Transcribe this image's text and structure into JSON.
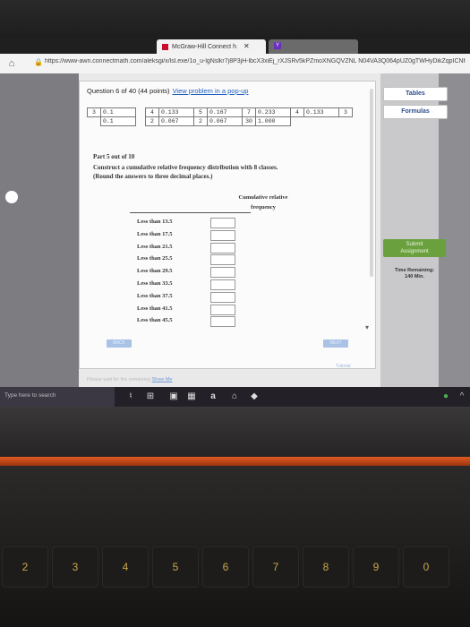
{
  "browser": {
    "tabs": [
      {
        "title": "McGraw-Hill Connect h",
        "close": "✕",
        "active": true
      },
      {
        "title": "Y",
        "active": false
      }
    ],
    "url": "https://www-awn.connectmath.com/aleksgi/x/lsl.exe/1o_u-lgNslkr7j8P3jH-lbcX3xiEj_rXJSRv5kPZmoXNGQVZNL N04VA3Q064pUZ0gTWHyDikZqpICNfgf"
  },
  "question": {
    "header": "Question 6 of 40 (44 points)",
    "popup_link": "View problem in a pop-up",
    "table": [
      [
        {
          "k": "3",
          "v": "0.1"
        },
        {
          "k": "4",
          "v": "0.133"
        },
        {
          "k": "5",
          "v": "0.167"
        },
        {
          "k": "7",
          "v": "0.233"
        },
        {
          "k": "4",
          "v": "0.133"
        },
        {
          "k": "3",
          "v": ""
        }
      ],
      [
        {
          "k": "",
          "v": "0.1"
        },
        {
          "k": "2",
          "v": "0.067"
        },
        {
          "k": "2",
          "v": "0.067"
        },
        {
          "k": "30",
          "v": "1.000"
        }
      ]
    ],
    "part": "Part 5 out of 10",
    "instruction_1": "Construct a cumulative relative frequency distribution with 8 classes.",
    "instruction_2": "(Round the answers to three decimal places.)",
    "col_head_1": "Cumulative relative",
    "col_head_2": "frequency",
    "rows": [
      {
        "label": "Less than 13.5",
        "value": ""
      },
      {
        "label": "Less than 17.5",
        "value": ""
      },
      {
        "label": "Less than 21.5",
        "value": ""
      },
      {
        "label": "Less than 25.5",
        "value": ""
      },
      {
        "label": "Less than 29.5",
        "value": ""
      },
      {
        "label": "Less than 33.5",
        "value": ""
      },
      {
        "label": "Less than 37.5",
        "value": ""
      },
      {
        "label": "Less than 41.5",
        "value": ""
      },
      {
        "label": "Less than 45.5",
        "value": ""
      }
    ],
    "back_label": "BACK",
    "next_label": "NEXT",
    "help_text": "Please wait for the remaining",
    "help_link": "Show Me",
    "tutorial": "Tutorial"
  },
  "sidebar": {
    "tables_label": "Tables",
    "formulas_label": "Formulas",
    "submit_label_1": "Submit",
    "submit_label_2": "Assignment",
    "timer_label": "Time Remaining:",
    "timer_value": "140 Min."
  },
  "taskbar": {
    "search_placeholder": "Type here to search"
  },
  "keyboard": {
    "keys": [
      "2",
      "3",
      "4",
      "5",
      "6",
      "7",
      "8",
      "9",
      "0"
    ]
  },
  "colors": {
    "link": "#1f5fbf",
    "submit": "#6aa13e",
    "sidebar_button_text": "#2e4e8c"
  }
}
